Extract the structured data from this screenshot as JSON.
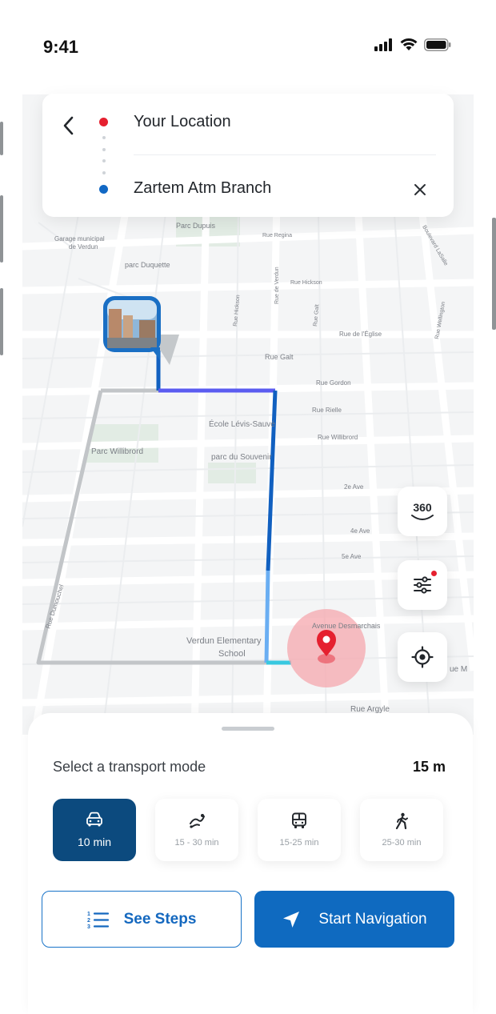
{
  "status_bar": {
    "time": "9:41"
  },
  "route": {
    "origin": "Your Location",
    "destination": "Zartem Atm Branch"
  },
  "map": {
    "labels": {
      "parc_dupuis": "Parc Dupuis",
      "rue_regina": "Rue Regina",
      "garage_1": "Garage municipal",
      "garage_2": "de Verdun",
      "parc_duquette": "parc Duquette",
      "rue_hickson": "Rue Hickson",
      "rue_eglise": "Rue de l'Église",
      "rue_galt": "Rue Galt",
      "rue_gordon": "Rue Gordon",
      "rue_rielle": "Rue Rielle",
      "ecole": "École Lévis-Sauvé",
      "rue_willibrord": "Rue Willibrord",
      "parc_willibrord": "Parc Willibrord",
      "parc_souvenir": "parc du Souvenir",
      "av_2e": "2e Ave",
      "av_4e": "4e Ave",
      "av_5e": "5e Ave",
      "av_desmarchais": "Avenue Desmarchais",
      "school_1": "Verdun Elementary",
      "school_2": "School",
      "rue_argyle": "Rue Argyle",
      "rue_cut": "ue M",
      "rue_dumouchel": "Rue Dumouchel",
      "rue_wellington": "Rue Wellington",
      "boul_lasalle": "Boulevard LaSalle",
      "rue_lafleur": "Rue de Verdun",
      "rue_hickson_v": "Rue Hickson",
      "rue_galt_v": "Rue Galt"
    },
    "map_buttons": {
      "label_360": "360"
    },
    "colors": {
      "route_dark": "#1160c0",
      "route_purple": "#5b5cf0",
      "route_light": "#6aaef2",
      "route_cyan": "#38c8e0",
      "alt_route": "#bfc2c5",
      "destination_pin": "#e5202f"
    }
  },
  "transport": {
    "title": "Select a transport mode",
    "distance": "15 m",
    "modes": [
      {
        "icon": "car-icon",
        "time": "10 min",
        "active": true
      },
      {
        "icon": "scooter-icon",
        "time": "15 - 30 min",
        "active": false
      },
      {
        "icon": "bus-icon",
        "time": "15-25 min",
        "active": false
      },
      {
        "icon": "walking-icon",
        "time": "25-30 min",
        "active": false
      }
    ]
  },
  "actions": {
    "steps_label": "See Steps",
    "start_label": "Start Navigation"
  }
}
